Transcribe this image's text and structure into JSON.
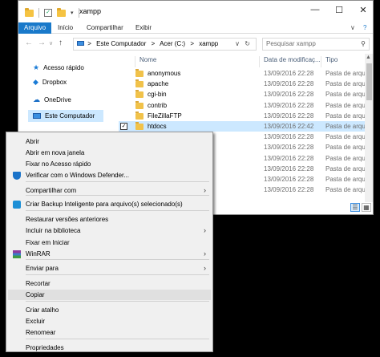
{
  "window": {
    "title": "xampp",
    "controls": {
      "minimize": "—",
      "maximize": "☐",
      "close": "✕"
    }
  },
  "ribbon": {
    "tabs": [
      "Arquivo",
      "Início",
      "Compartilhar",
      "Exibir"
    ],
    "collapse": "∨",
    "help": "?"
  },
  "address": {
    "back": "←",
    "forward": "→",
    "up": "↑",
    "path": [
      ">",
      "Este Computador",
      ">",
      "Acer (C:)",
      ">",
      "xampp"
    ],
    "dropdown": "∨",
    "refresh": "↻"
  },
  "search": {
    "placeholder": "Pesquisar xampp",
    "icon": "search-icon"
  },
  "nav_pane": {
    "items": [
      {
        "label": "Acesso rápido",
        "icon": "star-icon"
      },
      {
        "label": "Dropbox",
        "icon": "dropbox-icon"
      },
      {
        "label": "OneDrive",
        "icon": "cloud-icon"
      },
      {
        "label": "Este Computador",
        "icon": "computer-icon"
      }
    ]
  },
  "list": {
    "columns": [
      "Nome",
      "Data de modificaç...",
      "Tipo"
    ],
    "rows": [
      {
        "name": "anonymous",
        "date": "13/09/2016 22:28",
        "type": "Pasta de arquivos"
      },
      {
        "name": "apache",
        "date": "13/09/2016 22:28",
        "type": "Pasta de arquivos"
      },
      {
        "name": "cgi-bin",
        "date": "13/09/2016 22:28",
        "type": "Pasta de arquivos"
      },
      {
        "name": "contrib",
        "date": "13/09/2016 22:28",
        "type": "Pasta de arquivos"
      },
      {
        "name": "FileZillaFTP",
        "date": "13/09/2016 22:28",
        "type": "Pasta de arquivos"
      },
      {
        "name": "htdocs",
        "date": "13/09/2016 22:42",
        "type": "Pasta de arquivos",
        "selected": true
      },
      {
        "name": "",
        "date": "13/09/2016 22:28",
        "type": "Pasta de arquivos"
      },
      {
        "name": "",
        "date": "13/09/2016 22:28",
        "type": "Pasta de arquivos"
      },
      {
        "name": "",
        "date": "13/09/2016 22:28",
        "type": "Pasta de arquivos"
      },
      {
        "name": "",
        "date": "13/09/2016 22:28",
        "type": "Pasta de arquivos"
      },
      {
        "name": "",
        "date": "13/09/2016 22:28",
        "type": "Pasta de arquivos"
      },
      {
        "name": "",
        "date": "13/09/2016 22:28",
        "type": "Pasta de arquivos"
      }
    ]
  },
  "context_menu": {
    "items": [
      {
        "label": "Abrir"
      },
      {
        "label": "Abrir em nova janela"
      },
      {
        "label": "Fixar no Acesso rápido"
      },
      {
        "label": "Verificar com o Windows Defender...",
        "icon": "shield-icon"
      },
      {
        "label": "Compartilhar com",
        "submenu": "›"
      },
      {
        "label": "Criar Backup Inteligente para arquivo(s) selecionado(s)",
        "icon": "backup-icon"
      },
      {
        "label": "Restaurar versões anteriores"
      },
      {
        "label": "Incluir na biblioteca",
        "submenu": "›"
      },
      {
        "label": "Fixar em Iniciar"
      },
      {
        "label": "WinRAR",
        "icon": "winrar-icon",
        "submenu": "›"
      },
      {
        "label": "Enviar para",
        "submenu": "›"
      },
      {
        "label": "Recortar"
      },
      {
        "label": "Copiar",
        "hover": true
      },
      {
        "label": "Criar atalho"
      },
      {
        "label": "Excluir"
      },
      {
        "label": "Renomear"
      },
      {
        "label": "Propriedades"
      }
    ]
  },
  "colors": {
    "accent": "#1979ca",
    "selection": "#cce8ff",
    "folder": "#f1c24a"
  }
}
